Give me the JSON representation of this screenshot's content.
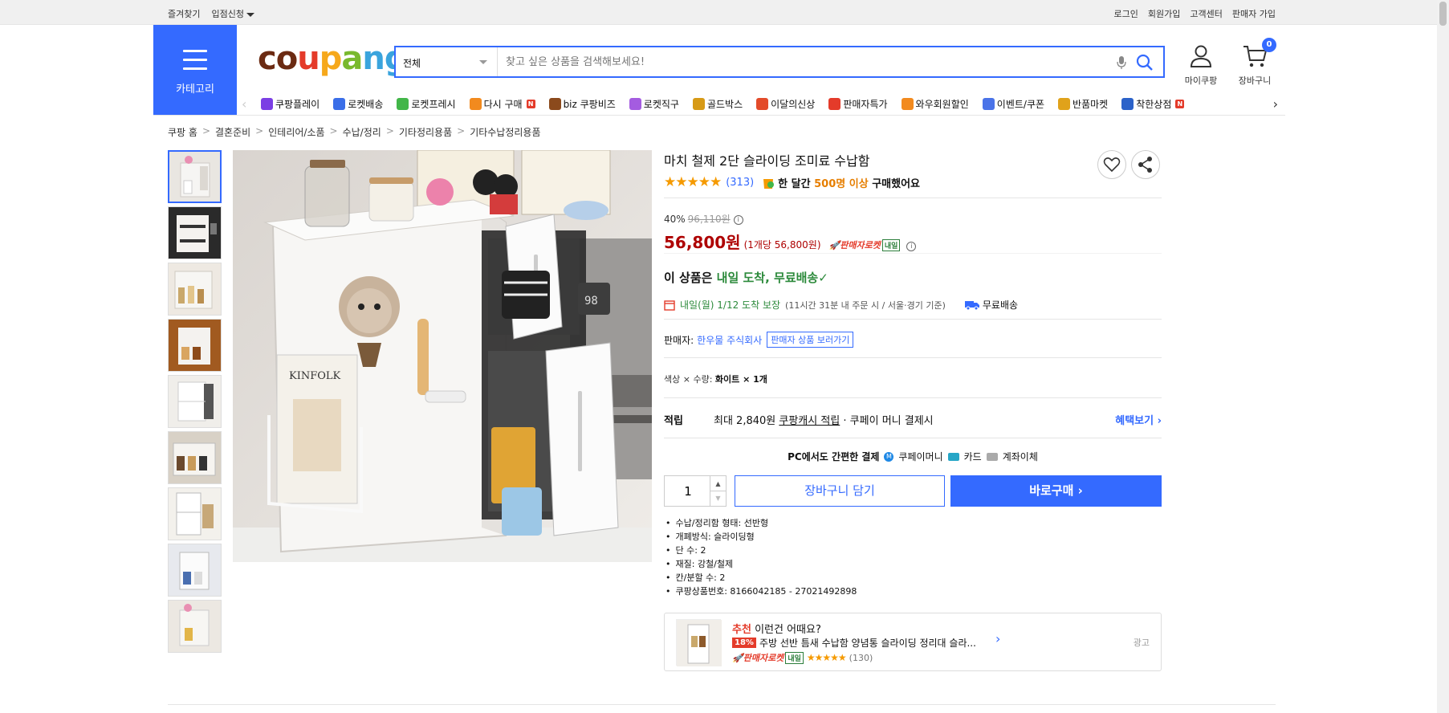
{
  "topbar": {
    "left": [
      "즐겨찾기",
      "입점신청"
    ],
    "right": [
      "로그인",
      "회원가입",
      "고객센터",
      "판매자 가입"
    ]
  },
  "header": {
    "category_label": "카테고리",
    "logo": [
      "c",
      "o",
      "u",
      "p",
      "a",
      "n",
      "g"
    ],
    "search_scope": "전체",
    "search_placeholder": "찾고 싶은 상품을 검색해보세요!",
    "mycoupang_label": "마이쿠팡",
    "cart_label": "장바구니",
    "cart_count": "0"
  },
  "nav": [
    {
      "label": "쿠팡플레이",
      "color": "#7b3fe4"
    },
    {
      "label": "로켓배송",
      "color": "#3a6ee8"
    },
    {
      "label": "로켓프레시",
      "color": "#42b649"
    },
    {
      "label": "다시 구매",
      "color": "#f28a1e",
      "badge": "N"
    },
    {
      "label": "biz 쿠팡비즈",
      "color": "#8b4a1c"
    },
    {
      "label": "로켓직구",
      "color": "#a45ce0"
    },
    {
      "label": "골드박스",
      "color": "#d79a16"
    },
    {
      "label": "이달의신상",
      "color": "#e34b2a"
    },
    {
      "label": "판매자특가",
      "color": "#e43b2a"
    },
    {
      "label": "와우회원할인",
      "color": "#f28a1e"
    },
    {
      "label": "이벤트/쿠폰",
      "color": "#4a73e8"
    },
    {
      "label": "반품마켓",
      "color": "#e0a21b"
    },
    {
      "label": "착한상점",
      "color": "#2b62c9",
      "badge": "N"
    }
  ],
  "breadcrumb": [
    "쿠팡 홈",
    "결혼준비",
    "인테리어/소품",
    "수납/정리",
    "기타정리용품",
    "기타수납정리용품"
  ],
  "product": {
    "title": "마치 철제 2단 슬라이딩 조미료 수납함",
    "rating": 4.5,
    "rating_stars": "★★★★★",
    "rating_count": "(313)",
    "bought_prefix": "한 달간",
    "bought_highlight": "500명 이상",
    "bought_suffix": "구매했어요",
    "discount_rate": "40%",
    "original_price": "96,110원",
    "sale_price": "56,800원",
    "unit_price": "(1개당 56,800원)",
    "rocket_label": "판매자로켓",
    "naeil_label": "내일",
    "arrival_title_prefix": "이 상품은",
    "arrival_title_green": "내일 도착, 무료배송",
    "arrival_date": "내일(월) 1/12 도착 보장",
    "arrival_note": "(11시간 31분 내 주문 시 / 서울⋅경기 기준)",
    "free_shipping": "무료배송",
    "seller_label": "판매자:",
    "seller_name": "한우물 주식회사",
    "seller_link": "판매자 상품 보러가기",
    "option_label": "색상 × 수량:",
    "option_value": "화이트 × 1개",
    "points_label": "적립",
    "points_prefix": "최대 2,840원",
    "points_link": "쿠팡캐시 적립",
    "points_suffix": "· 쿠페이 머니 결제시",
    "benefit_link": "혜택보기 ›",
    "pc_pay_label": "PC에서도 간편한 결제",
    "pay_methods": [
      "쿠페이머니",
      "카드",
      "계좌이체"
    ],
    "quantity": "1",
    "cart_button": "장바구니 담기",
    "buy_button": "바로구매 ›",
    "specs": [
      "수납/정리함 형태: 선반형",
      "개폐방식: 슬라이딩형",
      "단 수: 2",
      "재질: 강철/철제",
      "칸/분할 수: 2",
      "쿠팡상품번호: 8166042185 - 27021492898"
    ]
  },
  "recommend": {
    "title_red": "추천",
    "title_rest": "이런건 어때요?",
    "discount": "18%",
    "name": "주방 선반 틈새 수납함 양념통 슬라이딩 정리대 슬라...",
    "rocket": "판매자로켓",
    "naeil": "내일",
    "rating": 4.5,
    "stars": "★★★★★",
    "count": "(130)",
    "ad_label": "광고"
  },
  "colors": {
    "accent": "#346aff",
    "price_red": "#ae0000",
    "green": "#2c8a3b",
    "star": "#f59a00"
  }
}
